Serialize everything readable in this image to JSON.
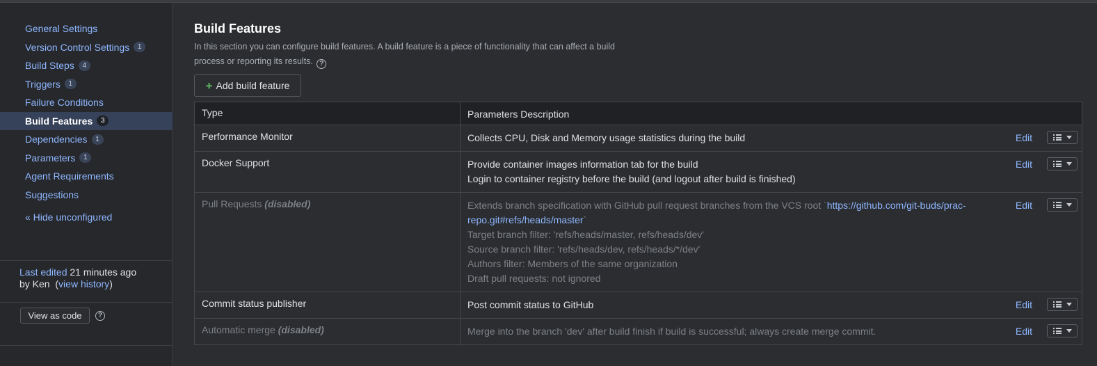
{
  "sidebar": {
    "items": [
      {
        "label": "General Settings",
        "badge": ""
      },
      {
        "label": "Version Control Settings",
        "badge": "1"
      },
      {
        "label": "Build Steps",
        "badge": "4"
      },
      {
        "label": "Triggers",
        "badge": "1"
      },
      {
        "label": "Failure Conditions",
        "badge": ""
      },
      {
        "label": "Build Features",
        "badge": "3",
        "active": true
      },
      {
        "label": "Dependencies",
        "badge": "1"
      },
      {
        "label": "Parameters",
        "badge": "1"
      },
      {
        "label": "Agent Requirements",
        "badge": ""
      },
      {
        "label": "Suggestions",
        "badge": ""
      }
    ],
    "hide_unconfigured": "« Hide unconfigured",
    "last_edited_label": "Last edited",
    "last_edited_time": "21 minutes ago",
    "by_text": "by Ken",
    "view_history": "view history",
    "view_as_code": "View as code"
  },
  "main": {
    "title": "Build Features",
    "description": "In this section you can configure build features. A build feature is a piece of functionality that can affect a build process or reporting its results.",
    "add_button": "Add build feature",
    "columns": [
      "Type",
      "Parameters Description"
    ],
    "edit_label": "Edit",
    "disabled_tag": "(disabled)",
    "features": [
      {
        "type": "Performance Monitor",
        "disabled": false,
        "lines": [
          "Collects CPU, Disk and Memory usage statistics during the build"
        ]
      },
      {
        "type": "Docker Support",
        "disabled": false,
        "lines": [
          "Provide container images information tab for the build",
          "Login to container registry before the build (and logout after build is finished)"
        ]
      },
      {
        "type": "Pull Requests",
        "disabled": true,
        "lead": "Extends branch specification with GitHub pull request branches from the VCS root `",
        "repo": "https://github.com/git-buds/prac-repo.git#refs/heads/master",
        "lead_end": "`",
        "lines": [
          "Target branch filter: 'refs/heads/master, refs/heads/dev'",
          "Source branch filter: 'refs/heads/dev, refs/heads/*/dev'",
          "Authors filter: Members of the same organization",
          "Draft pull requests: not ignored"
        ]
      },
      {
        "type": "Commit status publisher",
        "disabled": false,
        "lines": [
          "Post commit status to GitHub"
        ]
      },
      {
        "type": "Automatic merge",
        "disabled": true,
        "lines": [
          "Merge into the branch 'dev' after build finish if build is successful; always create merge commit."
        ]
      }
    ]
  },
  "colors": {
    "link": "#8fb6ff",
    "accent_plus": "#5fb85f",
    "active_nav": "#36415a"
  }
}
